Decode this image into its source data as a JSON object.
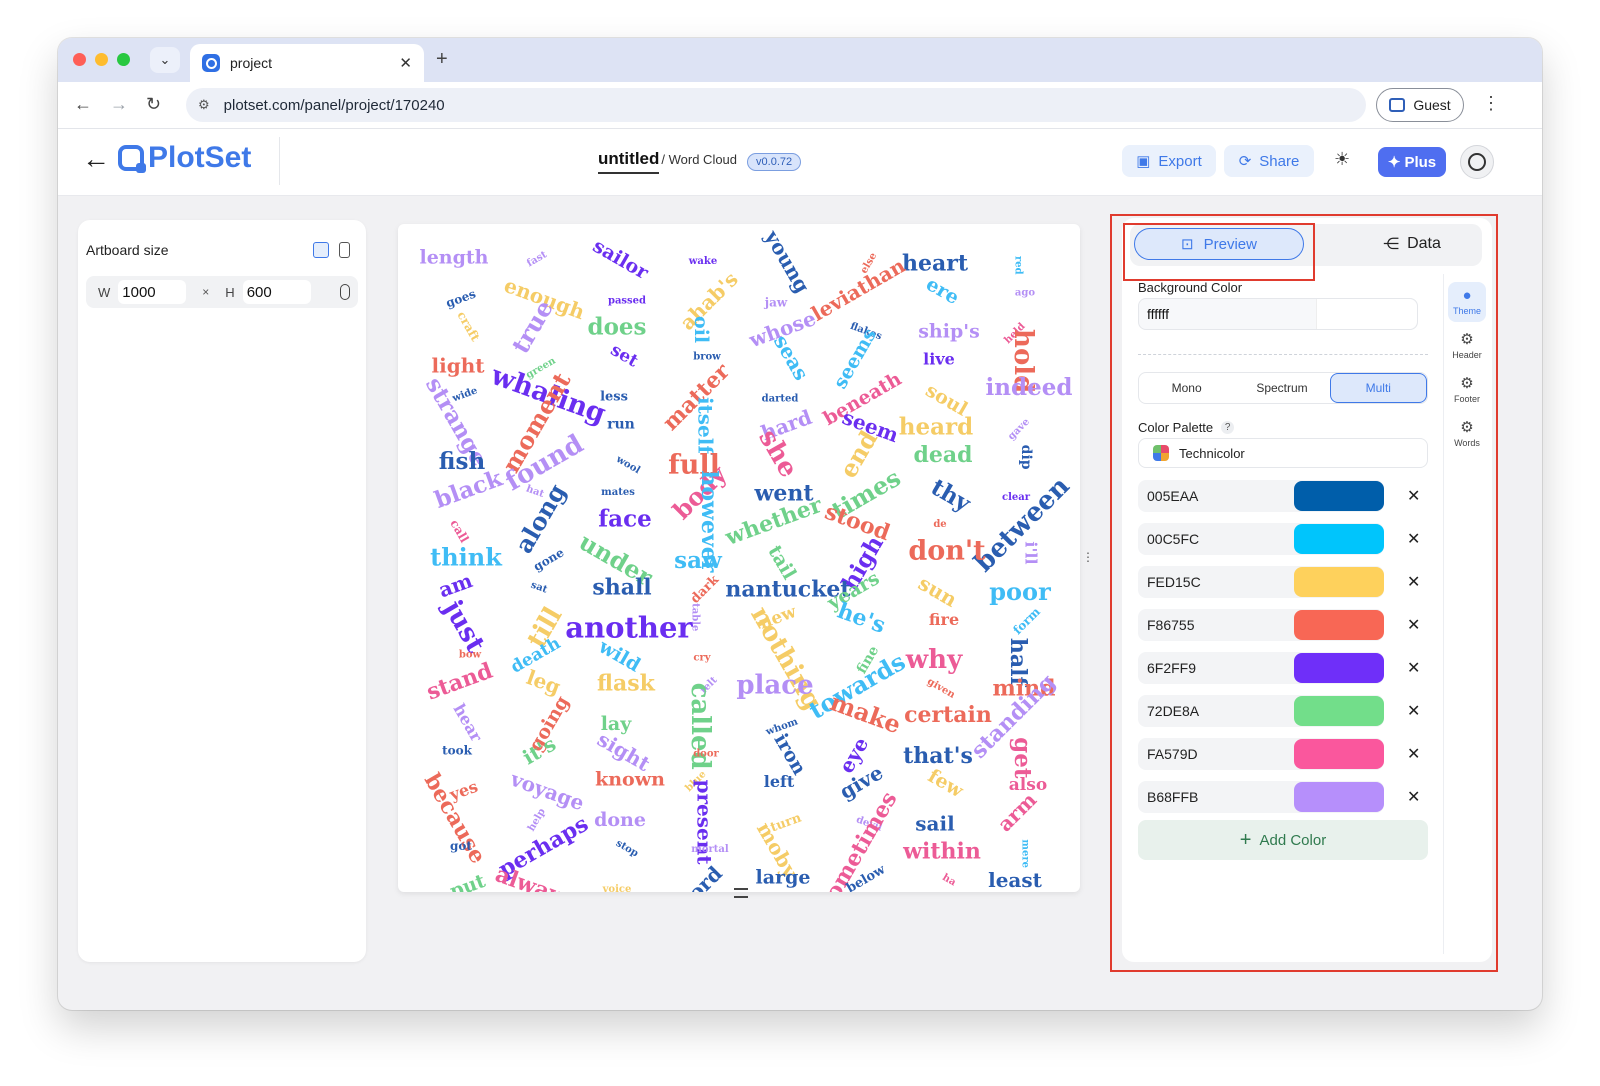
{
  "browser": {
    "tab_title": "project",
    "url": "plotset.com/panel/project/170240",
    "guest_label": "Guest"
  },
  "app": {
    "logo_text": "PlotSet",
    "project_name": "untitled",
    "chart_type": "/ Word Cloud",
    "version": "v0.0.72",
    "export_label": "Export",
    "share_label": "Share",
    "plus_label": "Plus"
  },
  "artboard": {
    "title": "Artboard size",
    "w_label": "W",
    "w_value": "1000",
    "x_sep": "×",
    "h_label": "H",
    "h_value": "600"
  },
  "right_panel": {
    "preview_label": "Preview",
    "data_label": "Data",
    "background_color_label": "Background Color",
    "background_color_value": "ffffff",
    "modes": [
      "Mono",
      "Spectrum",
      "Multi"
    ],
    "active_mode": "Multi",
    "palette_label": "Color Palette",
    "palette_help": "?",
    "palette_name": "Technicolor",
    "colors": [
      {
        "hex": "005EAA",
        "color": "#005EAA"
      },
      {
        "hex": "00C5FC",
        "color": "#00C5FC"
      },
      {
        "hex": "FED15C",
        "color": "#FED15C"
      },
      {
        "hex": "F86755",
        "color": "#F86755"
      },
      {
        "hex": "6F2FF9",
        "color": "#6F2FF9"
      },
      {
        "hex": "72DE8A",
        "color": "#72DE8A"
      },
      {
        "hex": "FA579D",
        "color": "#FA579D"
      },
      {
        "hex": "B68FFB",
        "color": "#B68FFB"
      }
    ],
    "remove_symbol": "✕",
    "add_color_label": "Add Color",
    "side_tabs": [
      "Theme",
      "Header",
      "Footer",
      "Words"
    ]
  },
  "word_cloud": {
    "palette": [
      "#2a5db0",
      "#3fbcf5",
      "#f5cc66",
      "#ec6a5a",
      "#6a2ef0",
      "#6fd18a",
      "#ec5b96",
      "#b48ff5"
    ],
    "words": [
      [
        "length",
        "#b48ff5",
        26
      ],
      [
        "fast",
        "#b48ff5",
        12
      ],
      [
        "sailor",
        "#6a2ef0",
        26
      ],
      [
        "wake",
        "#6a2ef0",
        12
      ],
      [
        "young",
        "#2a5db0",
        28
      ],
      [
        "else",
        "#ec6a5a",
        14
      ],
      [
        "heart",
        "#2a5db0",
        30
      ],
      [
        "red",
        "#3fbcf5",
        10
      ],
      [
        "goes",
        "#2a5db0",
        16
      ],
      [
        "enough",
        "#f5cc66",
        28
      ],
      [
        "passed",
        "#6a2ef0",
        14
      ],
      [
        "ahab's",
        "#f5cc66",
        28
      ],
      [
        "jaw",
        "#b48ff5",
        16
      ],
      [
        "leviathan",
        "#ec6a5a",
        28
      ],
      [
        "ere",
        "#3fbcf5",
        26
      ],
      [
        "ago",
        "#b48ff5",
        10
      ],
      [
        "craft",
        "#f5cc66",
        16
      ],
      [
        "true",
        "#b48ff5",
        34
      ],
      [
        "does",
        "#6fd18a",
        32
      ],
      [
        "oil",
        "#3fbcf5",
        26
      ],
      [
        "whose",
        "#b48ff5",
        28
      ],
      [
        "flakes",
        "#2a5db0",
        10
      ],
      [
        "ship's",
        "#b48ff5",
        26
      ],
      [
        "held",
        "#ec5b96",
        12
      ],
      [
        "light",
        "#ec6a5a",
        28
      ],
      [
        "green",
        "#6fd18a",
        14
      ],
      [
        "set",
        "#6a2ef0",
        24
      ],
      [
        "brow",
        "#2a5db0",
        14
      ],
      [
        "seas",
        "#3fbcf5",
        28
      ],
      [
        "seems",
        "#3fbcf5",
        26
      ],
      [
        "live",
        "#6a2ef0",
        22
      ],
      [
        "hold",
        "#ec6a5a",
        36
      ],
      [
        "wide",
        "#2a5db0",
        12
      ],
      [
        "whaling",
        "#6a2ef0",
        38
      ],
      [
        "less",
        "#2a5db0",
        18
      ],
      [
        "matter",
        "#ec6a5a",
        30
      ],
      [
        "darted",
        "#2a5db0",
        12
      ],
      [
        "beneath",
        "#ec5b96",
        26
      ],
      [
        "soul",
        "#f5cc66",
        26
      ],
      [
        "indeed",
        "#b48ff5",
        32
      ],
      [
        "strange",
        "#b48ff5",
        32
      ],
      [
        "moment",
        "#ec6a5a",
        34
      ],
      [
        "run",
        "#2a5db0",
        20
      ],
      [
        "itself",
        "#3fbcf5",
        28
      ],
      [
        "hard",
        "#b48ff5",
        28
      ],
      [
        "seem",
        "#6a2ef0",
        28
      ],
      [
        "heard",
        "#f5cc66",
        32
      ],
      [
        "gave",
        "#b48ff5",
        12
      ],
      [
        "fish",
        "#2a5db0",
        32
      ],
      [
        "found",
        "#b48ff5",
        36
      ],
      [
        "wool",
        "#2a5db0",
        10
      ],
      [
        "full",
        "#ec6a5a",
        38
      ],
      [
        "she",
        "#ec5b96",
        36
      ],
      [
        "end",
        "#f5cc66",
        34
      ],
      [
        "dead",
        "#6fd18a",
        30
      ],
      [
        "dip",
        "#2a5db0",
        20
      ],
      [
        "black",
        "#b48ff5",
        32
      ],
      [
        "hat",
        "#b48ff5",
        12
      ],
      [
        "mates",
        "#2a5db0",
        12
      ],
      [
        "body",
        "#ec5b96",
        34
      ],
      [
        "went",
        "#2a5db0",
        30
      ],
      [
        "times",
        "#6fd18a",
        34
      ],
      [
        "thy",
        "#2a5db0",
        32
      ],
      [
        "clear",
        "#6a2ef0",
        12
      ],
      [
        "call",
        "#ec5b96",
        16
      ],
      [
        "along",
        "#2a5db0",
        34
      ],
      [
        "face",
        "#6a2ef0",
        32
      ],
      [
        "however",
        "#3fbcf5",
        30
      ],
      [
        "whether",
        "#6fd18a",
        30
      ],
      [
        "stood",
        "#ec6a5a",
        30
      ],
      [
        "de",
        "#ec6a5a",
        12
      ],
      [
        "between",
        "#2a5db0",
        36
      ],
      [
        "think",
        "#3fbcf5",
        34
      ],
      [
        "gone",
        "#2a5db0",
        16
      ],
      [
        "under",
        "#6fd18a",
        34
      ],
      [
        "saw",
        "#3fbcf5",
        32
      ],
      [
        "tail",
        "#6fd18a",
        26
      ],
      [
        "high",
        "#6a2ef0",
        32
      ],
      [
        "don't",
        "#ec6a5a",
        38
      ],
      [
        "i'll",
        "#b48ff5",
        22
      ],
      [
        "am",
        "#6a2ef0",
        28
      ],
      [
        "sat",
        "#2a5db0",
        14
      ],
      [
        "shall",
        "#2a5db0",
        30
      ],
      [
        "dark",
        "#ec6a5a",
        18
      ],
      [
        "nantucket",
        "#2a5db0",
        30
      ],
      [
        "years",
        "#6fd18a",
        26
      ],
      [
        "sun",
        "#f5cc66",
        28
      ],
      [
        "poor",
        "#3fbcf5",
        34
      ],
      [
        "just",
        "#6a2ef0",
        36
      ],
      [
        "till",
        "#f5cc66",
        36
      ],
      [
        "another",
        "#6a2ef0",
        40
      ],
      [
        "table",
        "#b48ff5",
        10
      ],
      [
        "new",
        "#f5cc66",
        24
      ],
      [
        "he's",
        "#3fbcf5",
        30
      ],
      [
        "fire",
        "#ec6a5a",
        22
      ],
      [
        "form",
        "#3fbcf5",
        16
      ],
      [
        "bow",
        "#ec6a5a",
        12
      ],
      [
        "death",
        "#3fbcf5",
        24
      ],
      [
        "wild",
        "#3fbcf5",
        26
      ],
      [
        "cry",
        "#ec6a5a",
        12
      ],
      [
        "nothing",
        "#f5cc66",
        36
      ],
      [
        "fine",
        "#6fd18a",
        20
      ],
      [
        "why",
        "#ec5b96",
        36
      ],
      [
        "half",
        "#2a5db0",
        30
      ],
      [
        "stand",
        "#ec5b96",
        30
      ],
      [
        "leg",
        "#f5cc66",
        28
      ],
      [
        "flask",
        "#f5cc66",
        30
      ],
      [
        "felt",
        "#b48ff5",
        12
      ],
      [
        "place",
        "#b48ff5",
        36
      ],
      [
        "towards",
        "#3fbcf5",
        34
      ],
      [
        "given",
        "#ec6a5a",
        12
      ],
      [
        "mind",
        "#ec6a5a",
        30
      ],
      [
        "hear",
        "#b48ff5",
        22
      ],
      [
        "going",
        "#ec6a5a",
        26
      ],
      [
        "lay",
        "#6fd18a",
        26
      ],
      [
        "called",
        "#6fd18a",
        36
      ],
      [
        "whom",
        "#2a5db0",
        14
      ],
      [
        "make",
        "#ec6a5a",
        34
      ],
      [
        "certain",
        "#ec6a5a",
        30
      ],
      [
        "standing",
        "#b48ff5",
        30
      ],
      [
        "took",
        "#2a5db0",
        16
      ],
      [
        "it's",
        "#6fd18a",
        28
      ],
      [
        "sight",
        "#b48ff5",
        28
      ],
      [
        "door",
        "#ec6a5a",
        14
      ],
      [
        "iron",
        "#2a5db0",
        26
      ],
      [
        "eye",
        "#6a2ef0",
        28
      ],
      [
        "that's",
        "#2a5db0",
        30
      ],
      [
        "get",
        "#ec5b96",
        32
      ],
      [
        "yes",
        "#ec6a5a",
        22
      ],
      [
        "voyage",
        "#b48ff5",
        28
      ],
      [
        "known",
        "#ec6a5a",
        26
      ],
      [
        "blue",
        "#f5cc66",
        12
      ],
      [
        "left",
        "#2a5db0",
        22
      ],
      [
        "give",
        "#2a5db0",
        28
      ],
      [
        "few",
        "#f5cc66",
        26
      ],
      [
        "also",
        "#ec5b96",
        24
      ],
      [
        "because",
        "#ec6a5a",
        30
      ],
      [
        "help",
        "#b48ff5",
        12
      ],
      [
        "done",
        "#b48ff5",
        26
      ],
      [
        "present",
        "#6a2ef0",
        28
      ],
      [
        "turn",
        "#f5cc66",
        18
      ],
      [
        "devil",
        "#b48ff5",
        14
      ],
      [
        "sail",
        "#2a5db0",
        28
      ],
      [
        "arm",
        "#ec5b96",
        28
      ],
      [
        "got",
        "#2a5db0",
        16
      ],
      [
        "perhaps",
        "#6a2ef0",
        30
      ],
      [
        "stop",
        "#2a5db0",
        10
      ],
      [
        "mortal",
        "#b48ff5",
        12
      ],
      [
        "moby",
        "#f5cc66",
        28
      ],
      [
        "sometimes",
        "#ec5b96",
        30
      ],
      [
        "within",
        "#ec5b96",
        30
      ],
      [
        "mere",
        "#3fbcf5",
        14
      ],
      [
        "put",
        "#6fd18a",
        26
      ],
      [
        "always",
        "#ec5b96",
        30
      ],
      [
        "voice",
        "#f5cc66",
        14
      ],
      [
        "word",
        "#2a5db0",
        28
      ],
      [
        "large",
        "#2a5db0",
        26
      ],
      [
        "below",
        "#2a5db0",
        18
      ],
      [
        "ha",
        "#ec5b96",
        10
      ],
      [
        "least",
        "#2a5db0",
        28
      ]
    ]
  }
}
